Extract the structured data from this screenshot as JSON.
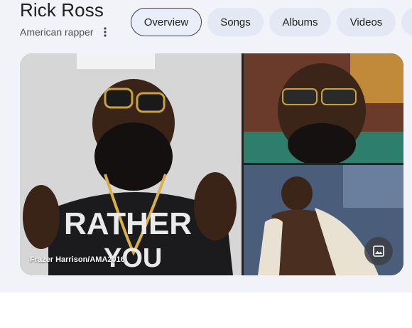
{
  "entity": {
    "title": "Rick Ross",
    "subtitle": "American rapper"
  },
  "tabs": [
    {
      "label": "Overview",
      "active": true
    },
    {
      "label": "Songs",
      "active": false
    },
    {
      "label": "Albums",
      "active": false
    },
    {
      "label": "Videos",
      "active": false
    }
  ],
  "gallery": {
    "main_credit": "Frazer Harrison/AMA2016",
    "images": [
      {
        "alt": "Rick Ross image 1"
      },
      {
        "alt": "Rick Ross image 2"
      },
      {
        "alt": "Rick Ross image 3"
      }
    ],
    "icon": "image-icon"
  },
  "colors": {
    "panel_bg": "#f1f3f8",
    "chip_bg": "#e3e8f4",
    "active_chip_border": "#3c4043",
    "text_primary": "#1f1f1f",
    "text_secondary": "#4d5156"
  }
}
